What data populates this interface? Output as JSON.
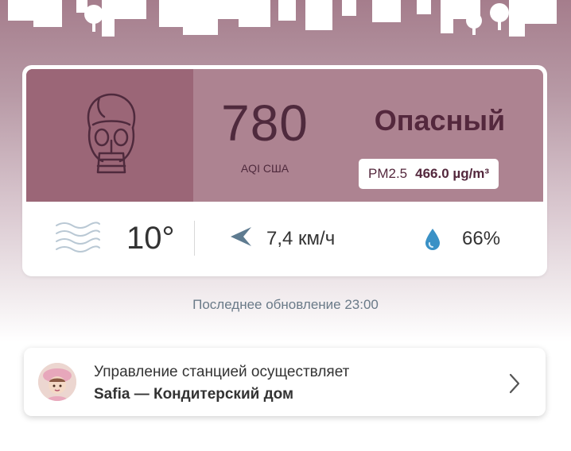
{
  "aqi": {
    "value": "780",
    "unit": "AQI США",
    "status": "Опасный",
    "pollutant": "PM2.5",
    "pollutant_value": "466.0 µg/m³"
  },
  "weather": {
    "temperature": "10°",
    "wind_speed": "7,4 км/ч",
    "humidity": "66%"
  },
  "last_update": "Последнее обновление 23:00",
  "station": {
    "line1": "Управление станцией осуществляет",
    "line2": "Safia — Кондитерский дом"
  },
  "icons": {
    "mask": "gas-mask-icon",
    "wind": "wind-lines-icon",
    "direction": "wind-direction-icon",
    "humidity": "water-drop-icon",
    "chevron": "chevron-right-icon"
  },
  "colors": {
    "status_band": "#ad8391",
    "mask_panel": "#9b6677",
    "text_dark": "#54283d",
    "drop": "#3a91c6"
  }
}
